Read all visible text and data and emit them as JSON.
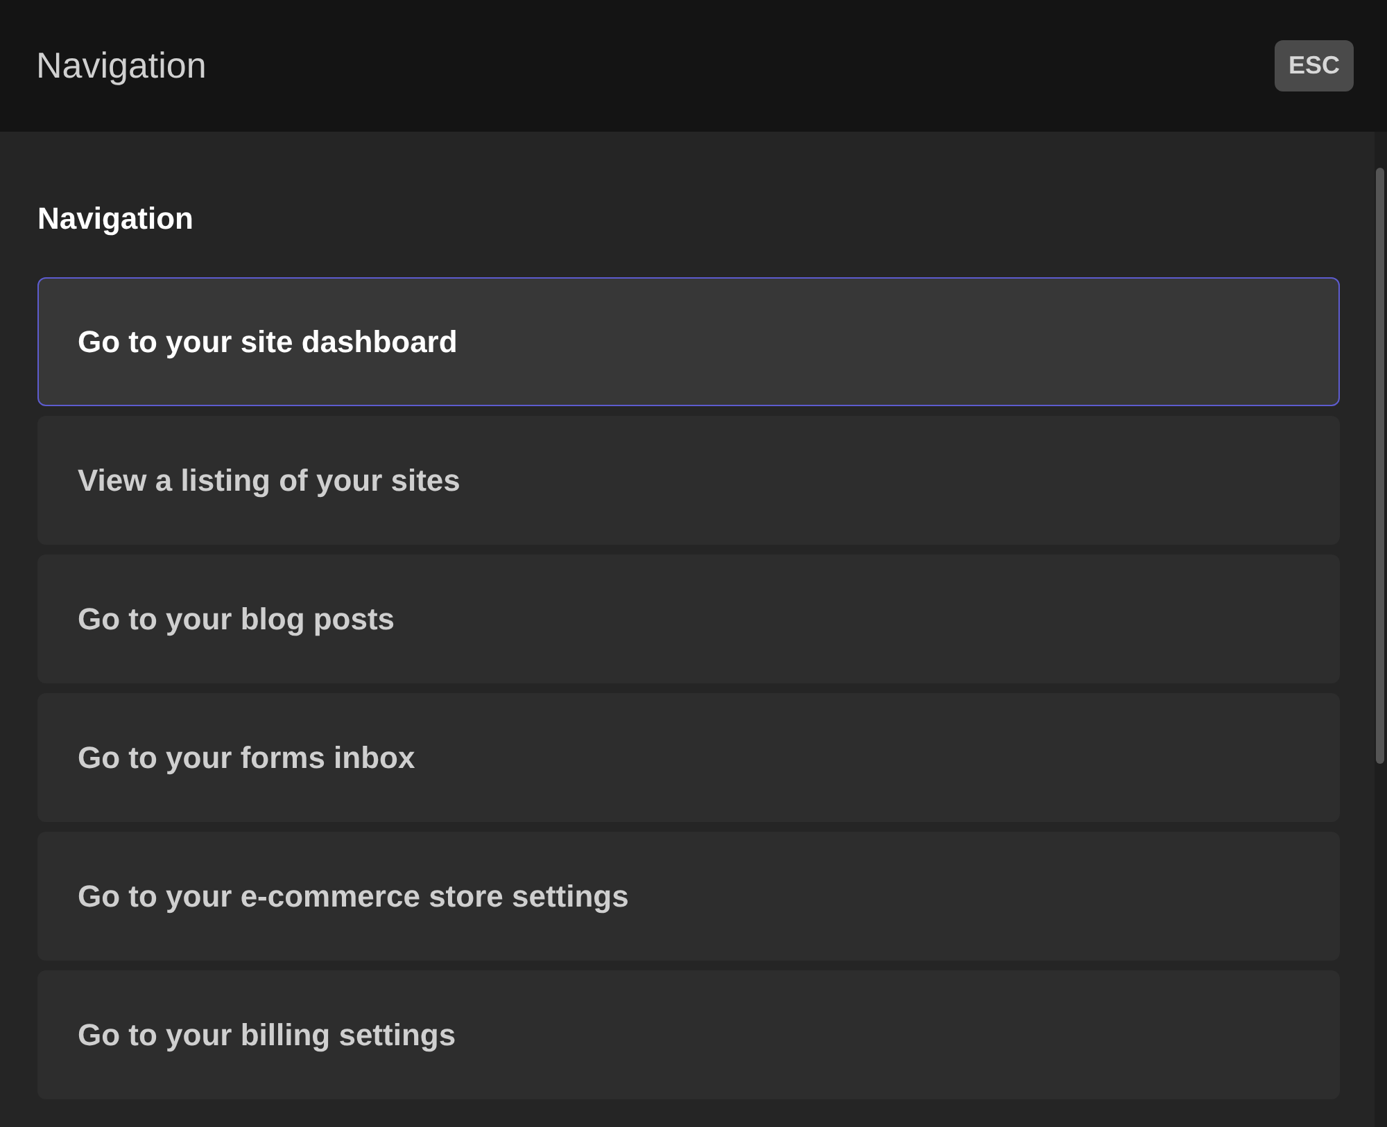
{
  "search": {
    "placeholder": "Navigation"
  },
  "esc_key": "ESC",
  "section": {
    "title": "Navigation",
    "items": [
      {
        "label": "Go to your site dashboard",
        "selected": true
      },
      {
        "label": "View a listing of your sites",
        "selected": false
      },
      {
        "label": "Go to your blog posts",
        "selected": false
      },
      {
        "label": "Go to your forms inbox",
        "selected": false
      },
      {
        "label": "Go to your e-commerce store settings",
        "selected": false
      },
      {
        "label": "Go to your billing settings",
        "selected": false
      }
    ]
  }
}
